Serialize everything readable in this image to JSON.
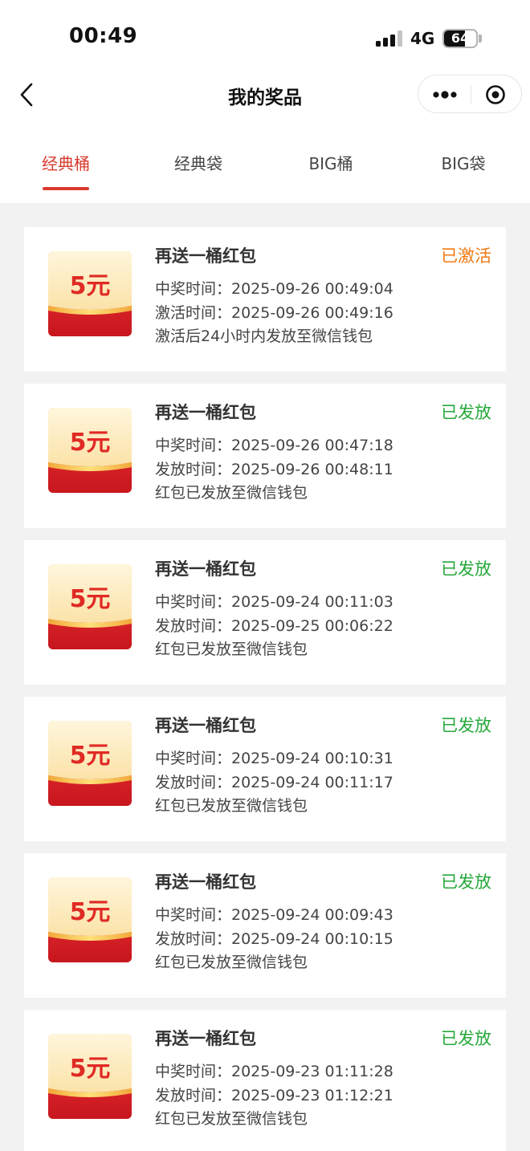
{
  "status_bar": {
    "time": "00:49",
    "network": "4G",
    "battery": "64"
  },
  "nav": {
    "title": "我的奖品"
  },
  "tabs": [
    {
      "label": "经典桶",
      "active": true
    },
    {
      "label": "经典袋",
      "active": false
    },
    {
      "label": "BIG桶",
      "active": false
    },
    {
      "label": "BIG袋",
      "active": false
    }
  ],
  "colors": {
    "accent": "#d83a2c",
    "activated": "#f07a12",
    "issued": "#25a83a"
  },
  "prizes": [
    {
      "thumb_text": "5元",
      "name": "再送一桶红包",
      "status": "已激活",
      "win_label": "中奖时间：",
      "win_time": "2025-09-26 00:49:04",
      "second_label": "激活时间：",
      "second_time": "2025-09-26 00:49:16",
      "note": "激活后24小时内发放至微信钱包"
    },
    {
      "thumb_text": "5元",
      "name": "再送一桶红包",
      "status": "已发放",
      "win_label": "中奖时间：",
      "win_time": "2025-09-26 00:47:18",
      "second_label": "发放时间：",
      "second_time": "2025-09-26 00:48:11",
      "note": "红包已发放至微信钱包"
    },
    {
      "thumb_text": "5元",
      "name": "再送一桶红包",
      "status": "已发放",
      "win_label": "中奖时间：",
      "win_time": "2025-09-24 00:11:03",
      "second_label": "发放时间：",
      "second_time": "2025-09-25 00:06:22",
      "note": "红包已发放至微信钱包"
    },
    {
      "thumb_text": "5元",
      "name": "再送一桶红包",
      "status": "已发放",
      "win_label": "中奖时间：",
      "win_time": "2025-09-24 00:10:31",
      "second_label": "发放时间：",
      "second_time": "2025-09-24 00:11:17",
      "note": "红包已发放至微信钱包"
    },
    {
      "thumb_text": "5元",
      "name": "再送一桶红包",
      "status": "已发放",
      "win_label": "中奖时间：",
      "win_time": "2025-09-24 00:09:43",
      "second_label": "发放时间：",
      "second_time": "2025-09-24 00:10:15",
      "note": "红包已发放至微信钱包"
    },
    {
      "thumb_text": "5元",
      "name": "再送一桶红包",
      "status": "已发放",
      "win_label": "中奖时间：",
      "win_time": "2025-09-23 01:11:28",
      "second_label": "发放时间：",
      "second_time": "2025-09-23 01:12:21",
      "note": "红包已发放至微信钱包"
    }
  ]
}
